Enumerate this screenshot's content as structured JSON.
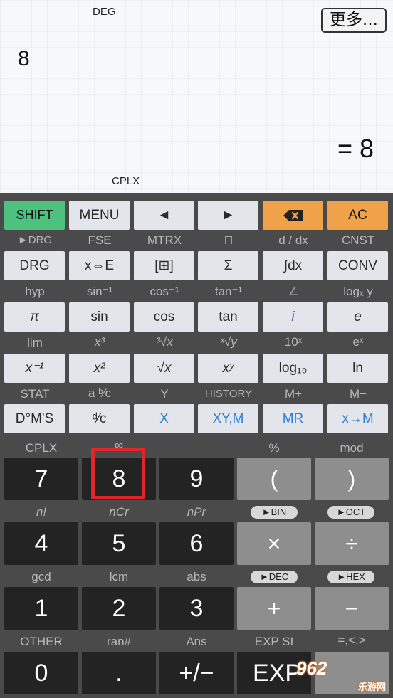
{
  "display": {
    "angle_mode": "DEG",
    "more_label": "更多...",
    "expression": "8",
    "result": "= 8",
    "complex_mode": "CPLX"
  },
  "row1": [
    "SHIFT",
    "MENU",
    "◄",
    "►",
    "⌫",
    "AC"
  ],
  "row1_icons": {
    "left": "arrow-left-icon",
    "right": "arrow-right-icon",
    "backspace": "backspace-icon"
  },
  "row2_labels": [
    "►DRG",
    "FSE",
    "MTRX",
    "Π",
    "d / dx",
    "CNST"
  ],
  "row2": [
    "DRG",
    "x⇔E",
    "[⊞]",
    "Σ",
    "∫dx",
    "CONV"
  ],
  "row3_labels": [
    "hyp",
    "sin⁻¹",
    "cos⁻¹",
    "tan⁻¹",
    "∠",
    "logₓ y"
  ],
  "row3": [
    "π",
    "sin",
    "cos",
    "tan",
    "i",
    "e"
  ],
  "row4_labels": [
    "lim",
    "x³",
    "³√x",
    "ˣ√y",
    "10ˣ",
    "eˣ"
  ],
  "row4": [
    "x⁻¹",
    "x²",
    "√x",
    "xʸ",
    "log₁₀",
    "ln"
  ],
  "row5_labels": [
    "STAT",
    "a ᵇ⁄c",
    "Y",
    "HISTORY",
    "M+",
    "M−"
  ],
  "row5": [
    "D°M'S",
    "ᵈ⁄c",
    "X",
    "XY,M",
    "MR",
    "x→M"
  ],
  "row6_labels": [
    "CPLX",
    "∞",
    "",
    "%",
    "mod"
  ],
  "row6": [
    "7",
    "8",
    "9",
    "(",
    ")"
  ],
  "row7_labels": [
    "n!",
    "nCr",
    "nPr",
    "►BIN",
    "►OCT"
  ],
  "row7": [
    "4",
    "5",
    "6",
    "×",
    "÷"
  ],
  "row8_labels": [
    "gcd",
    "lcm",
    "abs",
    "►DEC",
    "►HEX"
  ],
  "row8": [
    "1",
    "2",
    "3",
    "+",
    "−"
  ],
  "row9_labels": [
    "OTHER",
    "ran#",
    "Ans",
    "EXP SI",
    "=,<,>"
  ],
  "row9": [
    "0",
    ".",
    "+/−",
    "EXP",
    ""
  ],
  "watermark": {
    "text": "962",
    "sub": "乐游网"
  },
  "colors": {
    "shift": "#4fc17f",
    "orange": "#f0a24a",
    "highlight": "#e0262b",
    "blue_text": "#2c7fd8"
  }
}
